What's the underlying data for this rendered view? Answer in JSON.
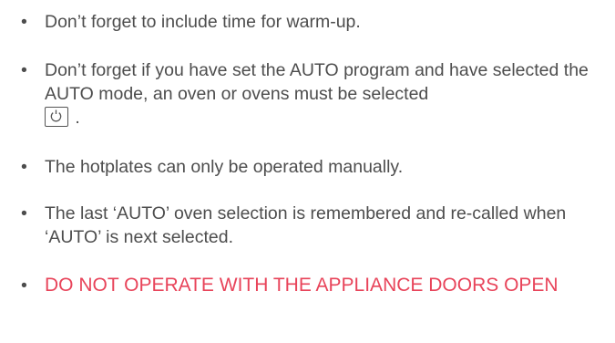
{
  "items": [
    {
      "text": "Don’t forget to include time for warm-up."
    },
    {
      "text": "Don’t forget if you have set the AUTO program and have selected the AUTO mode, an oven or ovens must be selected",
      "suffix": ".",
      "icon": "power-icon"
    },
    {
      "text": "The hotplates can only be operated manually."
    },
    {
      "text": "The last ‘AUTO’ oven selection is remembered and re-called when ‘AUTO’ is next selected."
    },
    {
      "text": "DO NOT OPERATE WITH THE APPLIANCE DOORS OPEN",
      "style": "warning"
    }
  ],
  "bullet": "•",
  "colors": {
    "text": "#4d4d4d",
    "warning": "#e8445a"
  }
}
